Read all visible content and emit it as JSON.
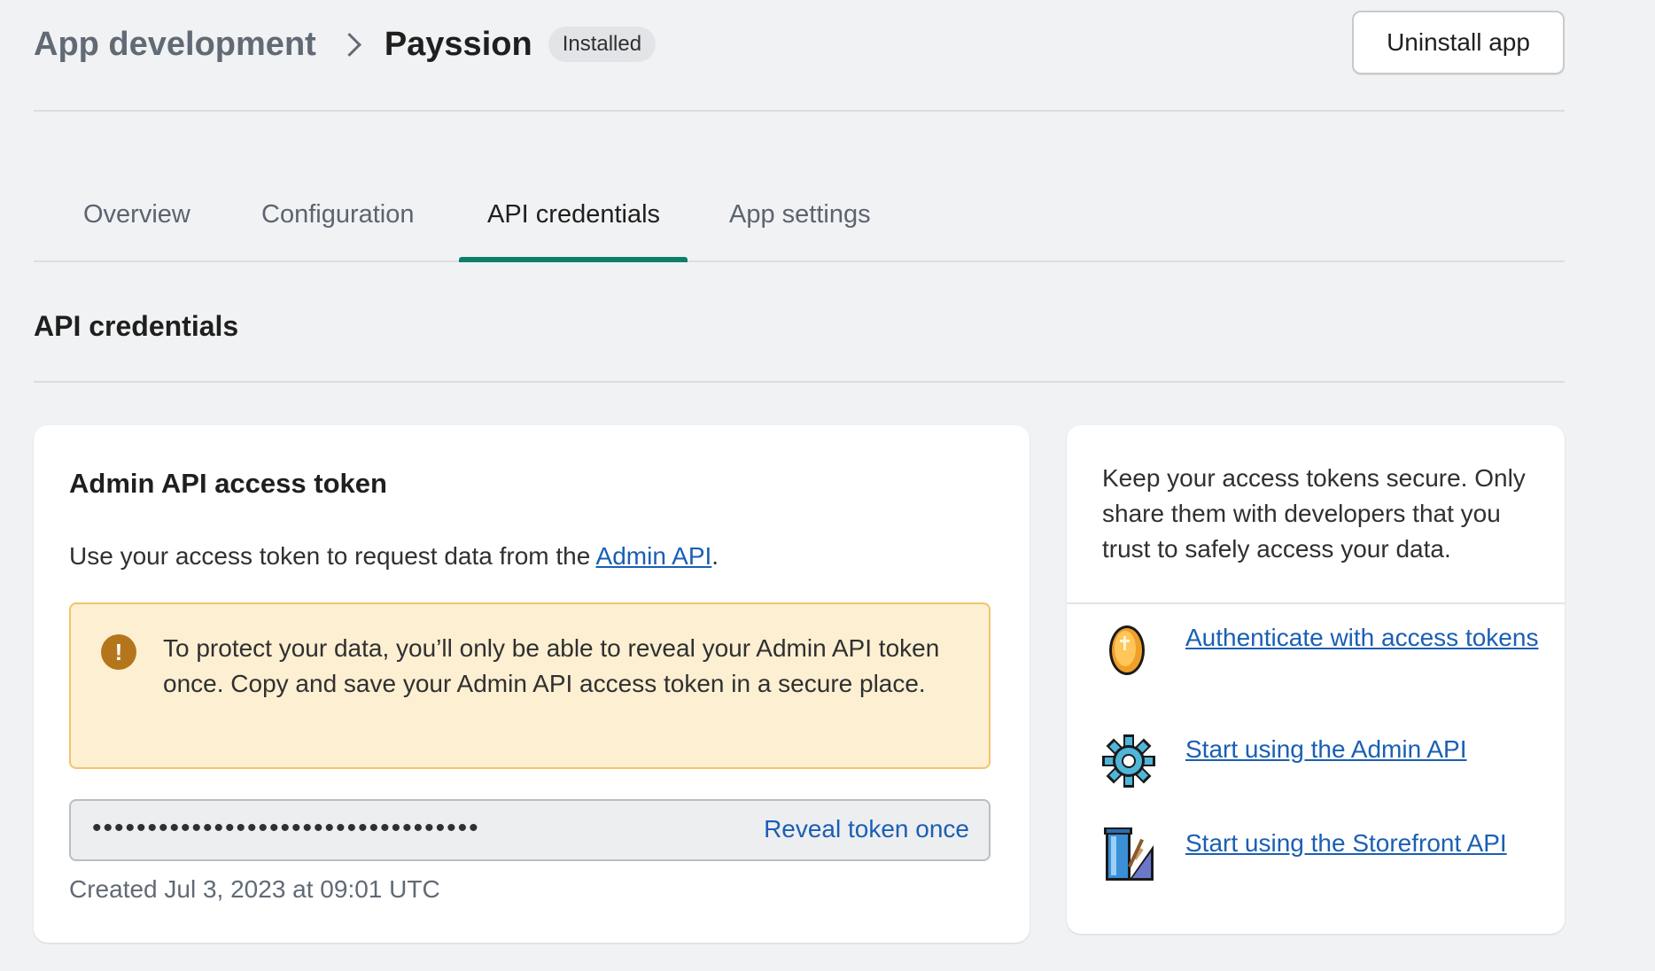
{
  "header": {
    "breadcrumb_parent": "App development",
    "app_name": "Payssion",
    "status_badge": "Installed",
    "uninstall_label": "Uninstall app"
  },
  "tabs": [
    {
      "label": "Overview",
      "active": false
    },
    {
      "label": "Configuration",
      "active": false
    },
    {
      "label": "API credentials",
      "active": true
    },
    {
      "label": "App settings",
      "active": false
    }
  ],
  "section": {
    "title": "API credentials"
  },
  "admin_token_card": {
    "title": "Admin API access token",
    "description_prefix": "Use your access token to request data from the ",
    "description_link": "Admin API",
    "description_suffix": ".",
    "warning_icon": "exclamation-icon",
    "warning_text": "To protect your data, you’ll only be able to reveal your Admin API token once. Copy and save your Admin API access token in a secure place.",
    "token_masked": "•••••••••••••••••••••••••••••••••••",
    "reveal_label": "Reveal token once",
    "created_text": "Created Jul 3, 2023 at 09:01 UTC"
  },
  "side_card": {
    "security_note": "Keep your access tokens secure. Only share them with developers that you trust to safely access your data.",
    "resources": [
      {
        "icon": "coin-icon",
        "label": "Authenticate with access tokens"
      },
      {
        "icon": "gear-icon",
        "label": "Start using the Admin API"
      },
      {
        "icon": "storefront-tools-icon",
        "label": "Start using the Storefront API"
      }
    ]
  },
  "colors": {
    "background": "#f1f2f4",
    "accent_tab": "#0f7f6b",
    "link": "#1a5fb4",
    "warning_bg": "#fdefd2",
    "warning_border": "#f1c46a",
    "warning_icon": "#b5761b"
  }
}
